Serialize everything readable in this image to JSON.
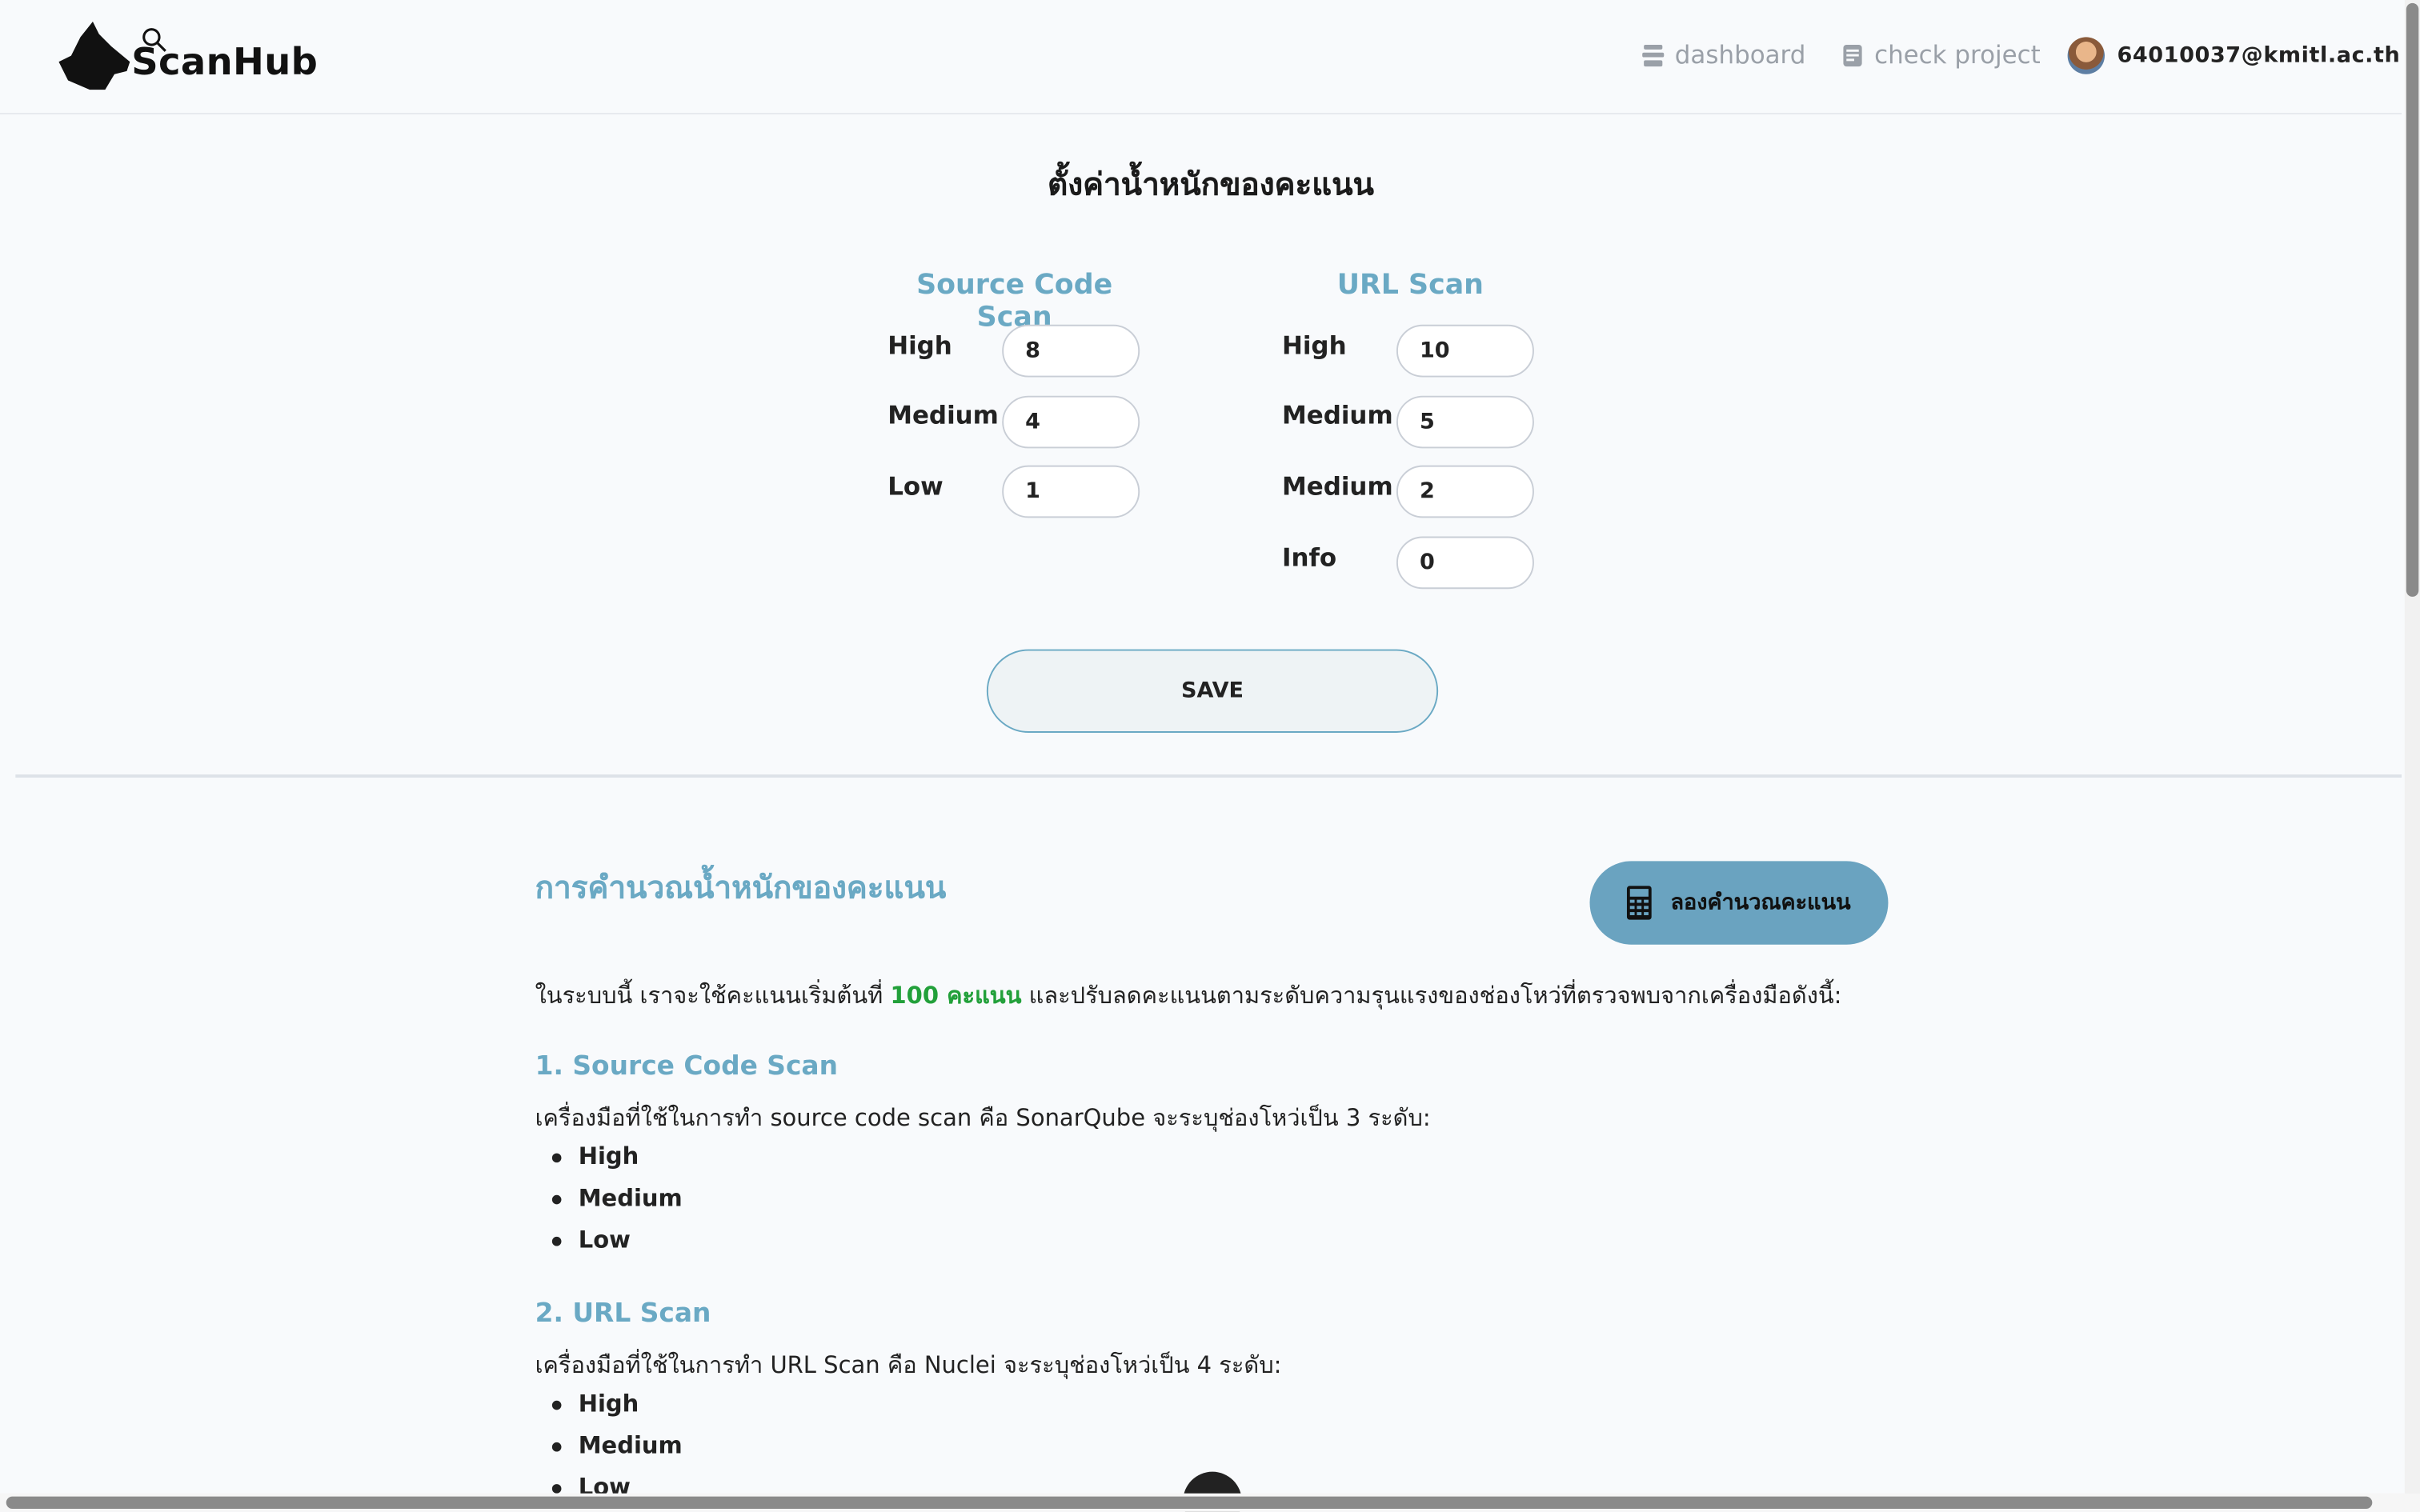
{
  "app": {
    "name": "ScanHub"
  },
  "nav": {
    "dashboard": "dashboard",
    "check_project": "check project",
    "user_email": "64010037@kmitl.ac.th"
  },
  "settings": {
    "title": "ตั้งค่าน้ำหนักของคะแนน",
    "source_code": {
      "title": "Source Code Scan",
      "fields": [
        {
          "label": "High",
          "value": "8"
        },
        {
          "label": "Medium",
          "value": "4"
        },
        {
          "label": "Low",
          "value": "1"
        }
      ]
    },
    "url_scan": {
      "title": "URL Scan",
      "fields": [
        {
          "label": "High",
          "value": "10"
        },
        {
          "label": "Medium",
          "value": "5"
        },
        {
          "label": "Medium",
          "value": "2"
        },
        {
          "label": "Info",
          "value": "0"
        }
      ]
    },
    "save_label": "SAVE"
  },
  "calculation": {
    "title": "การคำนวณน้ำหนักของคะแนน",
    "button_label": "ลองคำนวณคะแนน",
    "intro_before": "ในระบบนี้ เราจะใช้คะแนนเริ่มต้นที่",
    "intro_highlight": "100 คะแนน",
    "intro_after": "และปรับลดคะแนนตามระดับความรุนแรงของช่องโหว่ที่ตรวจพบจากเครื่องมือดังนี้:",
    "sections": [
      {
        "title": "1. Source Code Scan",
        "description": "เครื่องมือที่ใช้ในการทำ source code scan คือ SonarQube จะระบุช่องโหว่เป็น 3 ระดับ:",
        "levels": [
          "High",
          "Medium",
          "Low"
        ]
      },
      {
        "title": "2. URL Scan",
        "description": "เครื่องมือที่ใช้ในการทำ URL Scan คือ Nuclei จะระบุช่องโหว่เป็น 4 ระดับ:",
        "levels": [
          "High",
          "Medium",
          "Low"
        ]
      }
    ]
  },
  "colors": {
    "accent": "#6aa9c4",
    "button_bg": "#6aa3c0",
    "highlight": "#22a03a",
    "background": "#f8fafc"
  },
  "icons": {
    "dashboard": "dashboard-icon",
    "check_project": "document-icon",
    "calculator": "calculator-icon"
  }
}
